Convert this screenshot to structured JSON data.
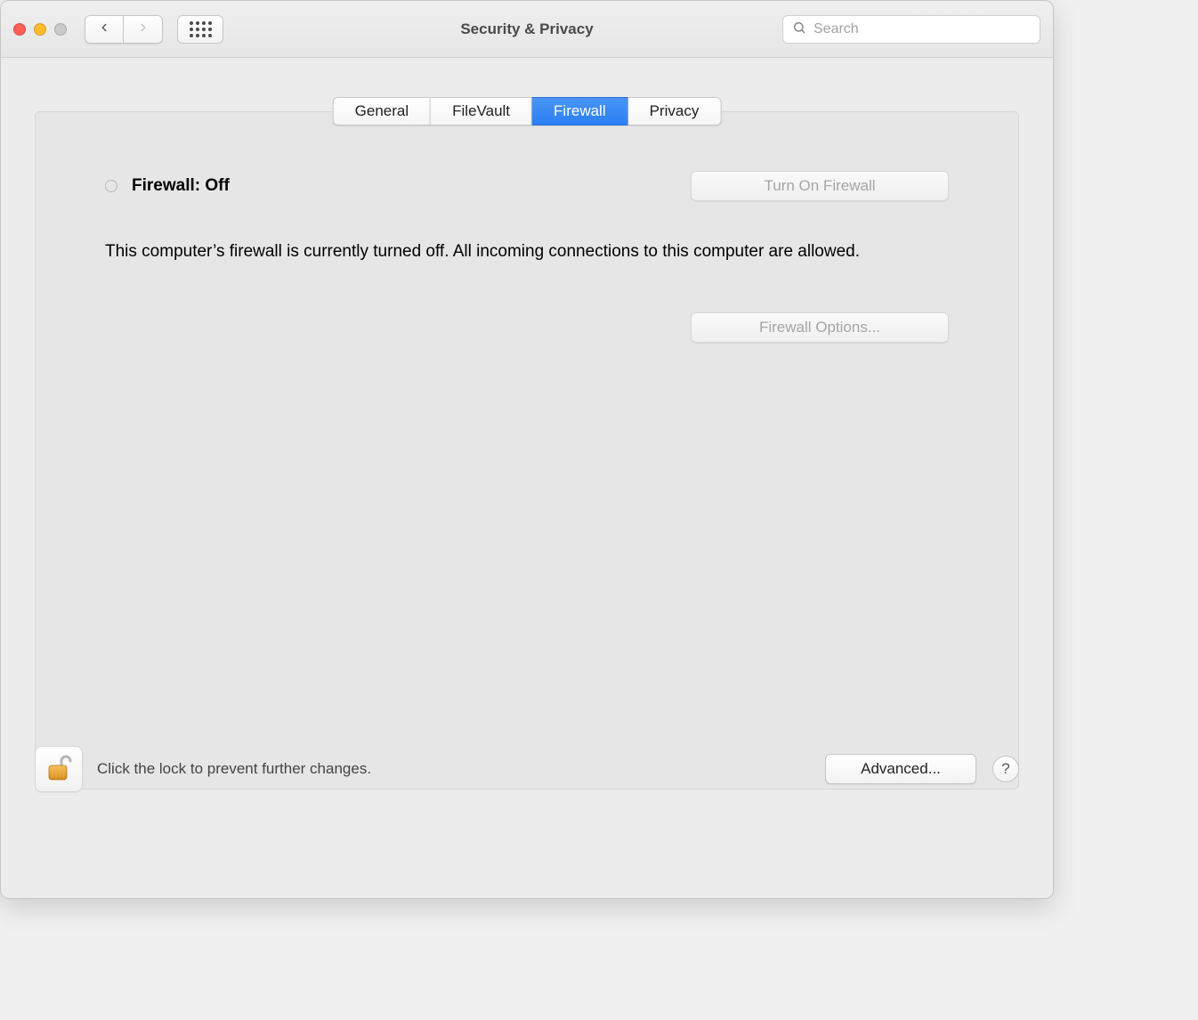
{
  "window": {
    "title": "Security & Privacy",
    "search_placeholder": "Search"
  },
  "tabs": {
    "general": "General",
    "filevault": "FileVault",
    "firewall": "Firewall",
    "privacy": "Privacy",
    "active": "firewall"
  },
  "firewall": {
    "status_label": "Firewall: Off",
    "turn_on_label": "Turn On Firewall",
    "description": "This computer’s firewall is currently turned off. All incoming connections to this computer are allowed.",
    "options_label": "Firewall Options..."
  },
  "footer": {
    "lock_hint": "Click the lock to prevent further changes.",
    "advanced_label": "Advanced...",
    "help_label": "?"
  }
}
